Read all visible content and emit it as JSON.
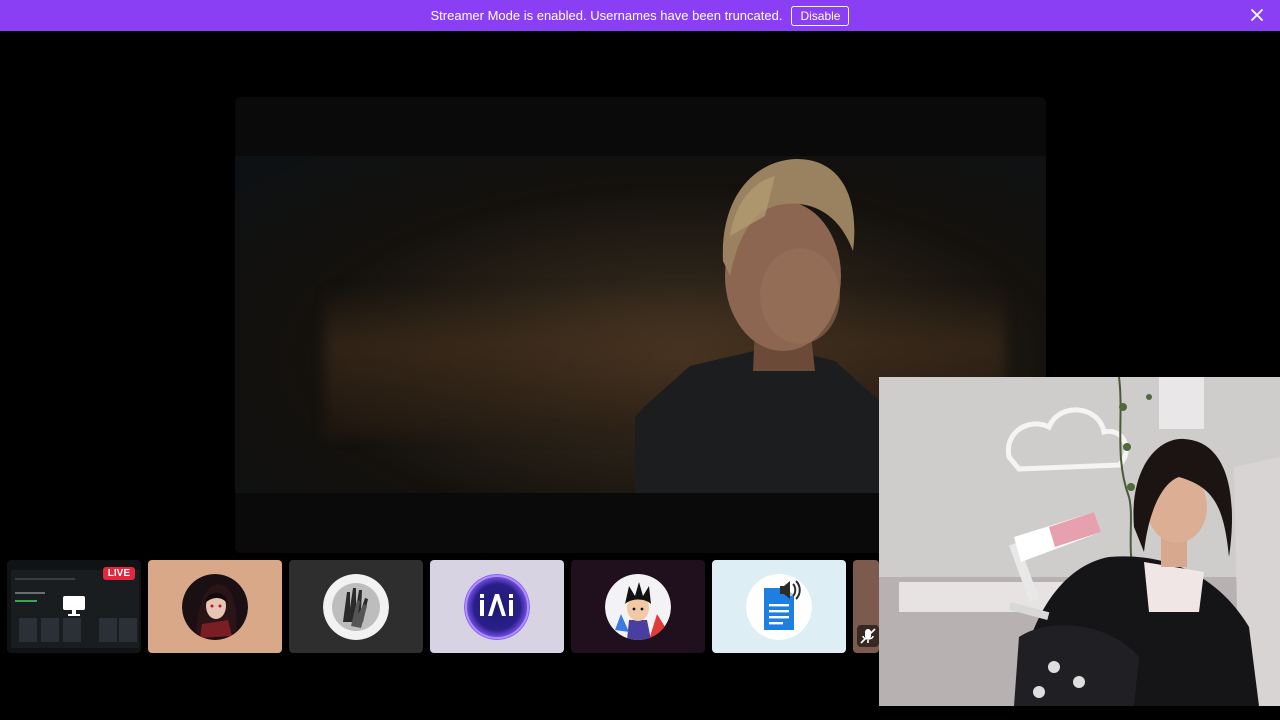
{
  "notice": {
    "message": "Streamer Mode is enabled. Usernames have been truncated.",
    "disable_label": "Disable"
  },
  "stage": {
    "video": "movie-scene"
  },
  "tiles": [
    {
      "kind": "screen-share",
      "badge": "LIVE",
      "icon": "monitor-icon",
      "color": "#101214"
    },
    {
      "kind": "user",
      "avatar": "anime-girl-avatar",
      "color": "#d9a889"
    },
    {
      "kind": "user",
      "avatar": "hands-avatar",
      "color": "#2e2e2e"
    },
    {
      "kind": "user",
      "avatar": "iai-logo-avatar",
      "color": "#d8d3e3"
    },
    {
      "kind": "user",
      "avatar": "anime-character-avatar",
      "color": "#200f1c"
    },
    {
      "kind": "user",
      "avatar": "document-speaker-avatar",
      "color": "#ddeef4"
    },
    {
      "kind": "user",
      "status": "muted",
      "icon": "mic-muted-icon",
      "color": "#7d5a4e"
    }
  ],
  "camera": {
    "feed": "webcam-stream"
  },
  "colors": {
    "notice_bg": "#8b3ff5",
    "live_badge": "#e4273f"
  }
}
